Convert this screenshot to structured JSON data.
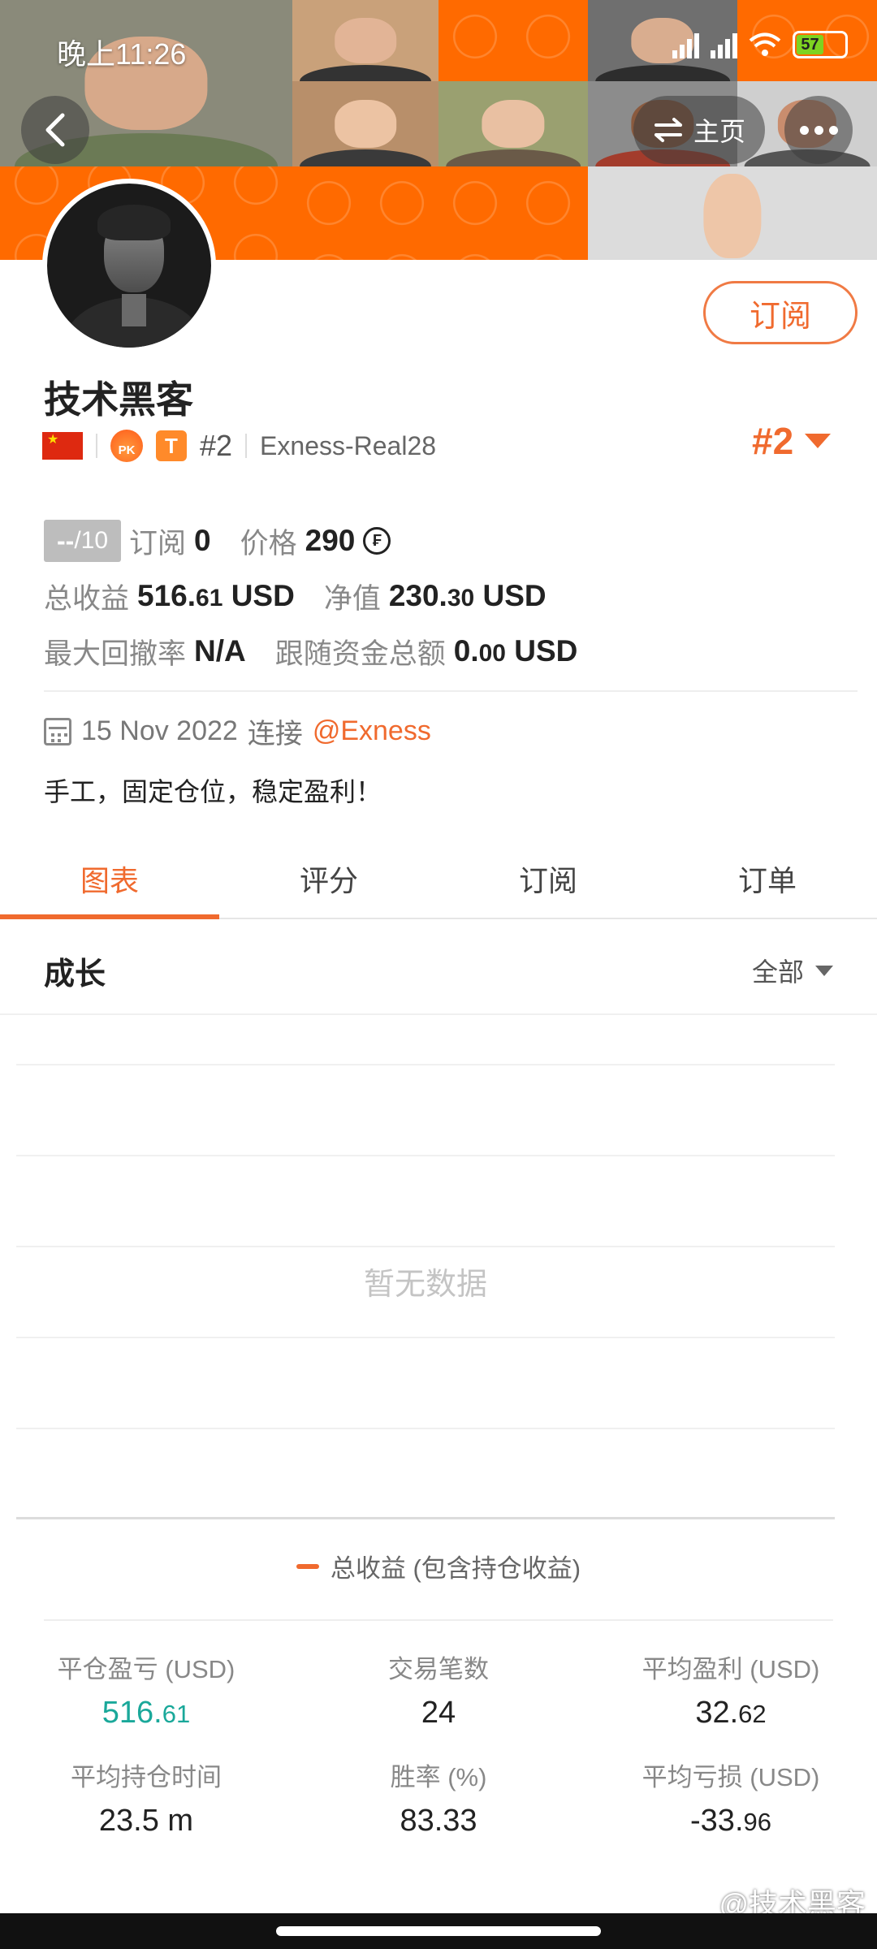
{
  "status_bar": {
    "time": "晚上11:26",
    "battery": "57"
  },
  "header": {
    "home_label": "主页"
  },
  "profile": {
    "subscribe_label": "订阅",
    "name": "技术黑客",
    "rank_small": "#2",
    "account": "Exness-Real28",
    "rank_big": "#2",
    "pk_badge": "PK",
    "t_badge": "T"
  },
  "stats": {
    "score": "--",
    "score_max": "/10",
    "subscribe_label": "订阅",
    "subscribe_count": "0",
    "price_label": "价格",
    "price_value": "290",
    "coin_symbol": "₣",
    "total_profit_label": "总收益",
    "total_profit_int": "516.",
    "total_profit_dec": "61",
    "total_profit_unit": "USD",
    "equity_label": "净值",
    "equity_int": "230.",
    "equity_dec": "30",
    "equity_unit": "USD",
    "max_drawdown_label": "最大回撤率",
    "max_drawdown_value": "N/A",
    "follow_funds_label": "跟随资金总额",
    "follow_funds_int": "0.",
    "follow_funds_dec": "00",
    "follow_funds_unit": "USD"
  },
  "connection": {
    "date": "15 Nov 2022",
    "connect_label": "连接",
    "broker": "@Exness"
  },
  "description": "手工，固定仓位，稳定盈利！",
  "tabs": [
    {
      "label": "图表",
      "active": true
    },
    {
      "label": "评分",
      "active": false
    },
    {
      "label": "订阅",
      "active": false
    },
    {
      "label": "订单",
      "active": false
    }
  ],
  "chart_section": {
    "title": "成长",
    "filter": "全部",
    "no_data": "暂无数据",
    "legend": "总收益 (包含持仓收益)"
  },
  "chart_data": {
    "type": "line",
    "title": "成长",
    "series": [
      {
        "name": "总收益 (包含持仓收益)",
        "values": []
      }
    ],
    "grid": true,
    "legend_position": "bottom",
    "empty_message": "暂无数据"
  },
  "metrics": [
    {
      "label": "平仓盈亏 (USD)",
      "value_int": "516.",
      "value_dec": "61",
      "color": "#1aa89a"
    },
    {
      "label": "交易笔数",
      "value_int": "24",
      "value_dec": ""
    },
    {
      "label": "平均盈利 (USD)",
      "value_int": "32.",
      "value_dec": "62"
    },
    {
      "label": "平均持仓时间",
      "value_int": "23.5 m",
      "value_dec": ""
    },
    {
      "label": "胜率 (%)",
      "value_int": "83.33",
      "value_dec": ""
    },
    {
      "label": "平均亏损 (USD)",
      "value_int": "-33.",
      "value_dec": "96"
    }
  ],
  "watermark": "@技术黑客",
  "colors": {
    "accent": "#f06a2e",
    "banner": "#ff6a00",
    "positive": "#1aa89a"
  }
}
